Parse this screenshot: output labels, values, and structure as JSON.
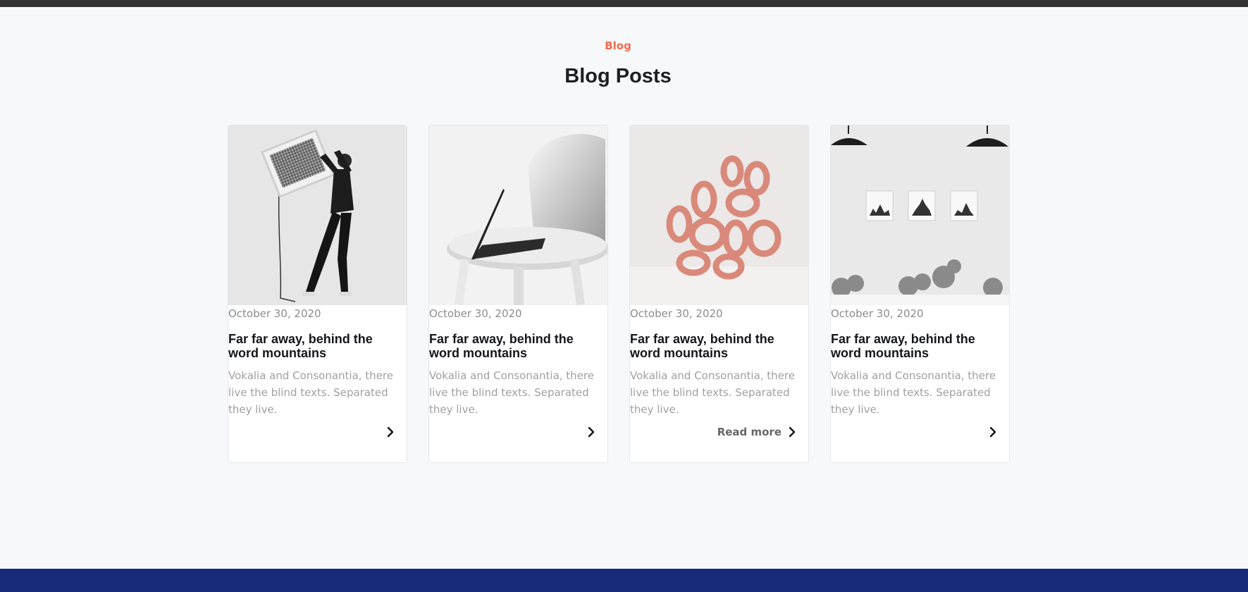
{
  "section": {
    "eyebrow": "Blog",
    "title": "Blog Posts"
  },
  "posts": [
    {
      "date": "October 30, 2020",
      "title": "Far far away, behind the word mountains",
      "excerpt": "Vokalia and Consonantia, there live the blind texts. Separated they live.",
      "link_label": "",
      "image_icon": "man-with-tv-photo"
    },
    {
      "date": "October 30, 2020",
      "title": "Far far away, behind the word mountains",
      "excerpt": "Vokalia and Consonantia, there live the blind texts. Separated they live.",
      "link_label": "",
      "image_icon": "laptop-on-chair-photo"
    },
    {
      "date": "October 30, 2020",
      "title": "Far far away, behind the word mountains",
      "excerpt": "Vokalia and Consonantia, there live the blind texts. Separated they live.",
      "link_label": "Read more",
      "image_icon": "copper-rings-photo"
    },
    {
      "date": "October 30, 2020",
      "title": "Far far away, behind the word mountains",
      "excerpt": "Vokalia and Consonantia, there live the blind texts. Separated they live.",
      "link_label": "",
      "image_icon": "office-wall-frames-photo"
    }
  ],
  "colors": {
    "accent": "#f36b4f",
    "footer": "#172a7a",
    "top_bar": "#343434"
  }
}
